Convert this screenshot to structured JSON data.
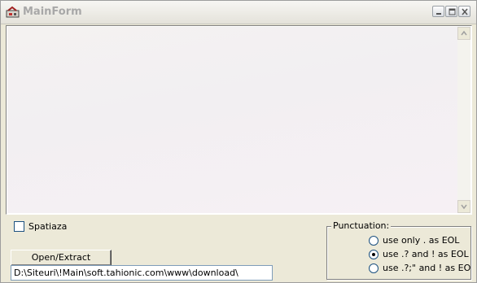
{
  "window": {
    "title": "MainForm"
  },
  "options": {
    "spatiaza_label": "Spatiaza",
    "spatiaza_checked": false
  },
  "actions": {
    "open_extract_label": "Open/Extract"
  },
  "path": {
    "value": "D:\\Siteuri\\!Main\\soft.tahionic.com\\www\\download\\"
  },
  "punctuation": {
    "title": "Punctuation:",
    "options": [
      {
        "label": "use only . as EOL",
        "selected": false
      },
      {
        "label": "use .? and ! as EOL",
        "selected": true
      },
      {
        "label": "use .?;\" and ! as EO",
        "selected": false
      }
    ]
  }
}
